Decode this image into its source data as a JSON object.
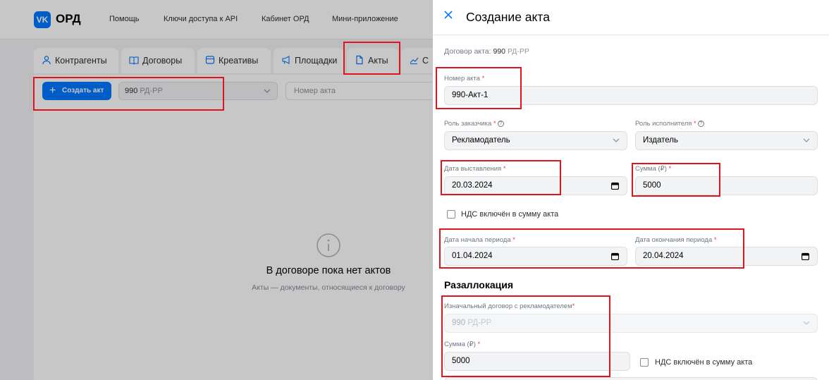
{
  "app": {
    "logo_text": "ОРД",
    "nav": [
      "Помощь",
      "Ключи доступа к API",
      "Кабинет ОРД",
      "Мини-приложение"
    ]
  },
  "tabs": [
    {
      "label": "Контрагенты",
      "icon": "user-icon"
    },
    {
      "label": "Договоры",
      "icon": "book-icon"
    },
    {
      "label": "Креативы",
      "icon": "layout-icon"
    },
    {
      "label": "Площадки",
      "icon": "megaphone-icon"
    },
    {
      "label": "Акты",
      "icon": "document-icon"
    },
    {
      "label": "С",
      "icon": "chart-icon"
    }
  ],
  "toolbar": {
    "create_label": "Создать акт",
    "contract_num": "990",
    "contract_suffix": "РД-РР",
    "act_number_placeholder": "Номер акта"
  },
  "empty": {
    "title": "В договоре пока нет актов",
    "subtitle": "Акты — документы, относящиеся к договору"
  },
  "modal": {
    "title": "Создание акта",
    "contract_prefix": "Договор акта:",
    "contract_num": "990",
    "contract_suffix": "РД-РР",
    "act_number": {
      "label": "Номер акта",
      "value": "990-Акт-1"
    },
    "customer_role": {
      "label": "Роль заказчика",
      "value": "Рекламодатель"
    },
    "executor_role": {
      "label": "Роль исполнителя",
      "value": "Издатель"
    },
    "issue_date": {
      "label": "Дата выставления",
      "value": "20.03.2024"
    },
    "amount": {
      "label": "Сумма (₽)",
      "value": "5000"
    },
    "vat_label": "НДС включён в сумму акта",
    "period_start": {
      "label": "Дата начала периода",
      "value": "01.04.2024"
    },
    "period_end": {
      "label": "Дата окончания периода",
      "value": "20.04.2024"
    },
    "reallocation": {
      "title": "Разаллокация",
      "original_contract_label": "Изначальный договор с рекламодателем",
      "original_contract_num": "990",
      "original_contract_suffix": "РД-РР",
      "amount_label": "Сумма (₽)",
      "amount_value": "5000",
      "vat_label": "НДС включён в сумму акта"
    }
  },
  "colors": {
    "accent": "#0077ff",
    "highlight": "#e0141c",
    "required": "#e64646"
  }
}
